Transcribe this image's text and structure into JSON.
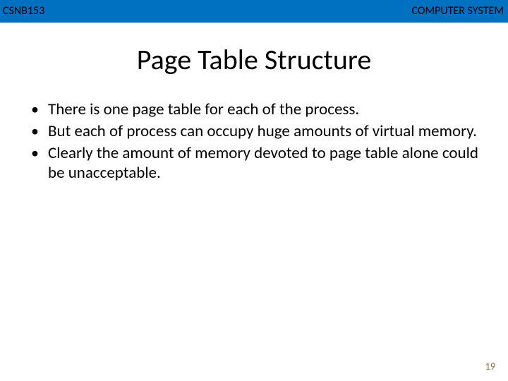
{
  "header": {
    "course_code": "CSNB153",
    "course_title": "COMPUTER SYSTEM"
  },
  "title": "Page Table Structure",
  "bullets": [
    "There is one page table for each of the process.",
    "But each of process can occupy huge amounts of virtual memory.",
    "Clearly the amount of memory devoted to page table alone could be unacceptable."
  ],
  "page_number": "19"
}
